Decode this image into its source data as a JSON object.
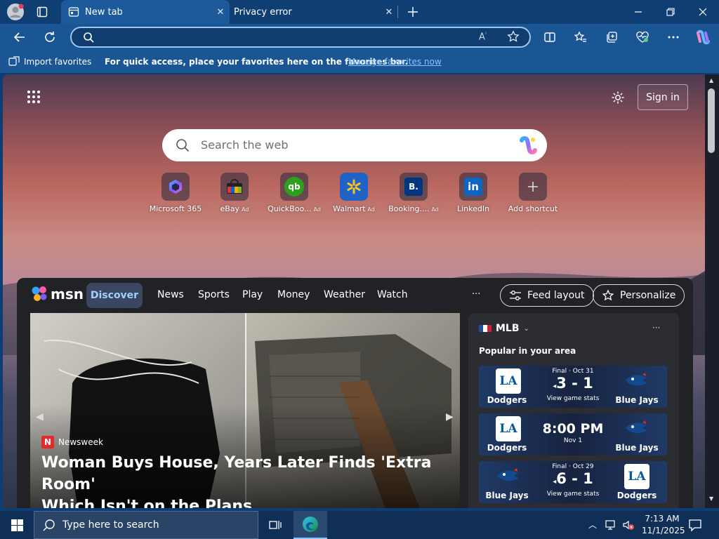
{
  "browser": {
    "tabs": [
      {
        "label": "New tab",
        "active": true
      },
      {
        "label": "Privacy error",
        "active": false
      }
    ],
    "address": {
      "value": "",
      "placeholder": ""
    },
    "favorites_bar": {
      "import_label": "Import favorites",
      "hint": "For quick access, place your favorites here on the favorites bar.",
      "manage_link": "Manage favorites now"
    }
  },
  "newtab": {
    "sign_in": "Sign in",
    "search_placeholder": "Search the web",
    "shortcuts": [
      {
        "label": "Microsoft 365",
        "ad": "",
        "icon": "microsoft-365-icon"
      },
      {
        "label": "eBay",
        "ad": "Ad",
        "icon": "ebay-icon"
      },
      {
        "label": "QuickBoo...",
        "ad": "Ad",
        "icon": "quickbooks-icon"
      },
      {
        "label": "Walmart",
        "ad": "Ad",
        "icon": "walmart-icon"
      },
      {
        "label": "Booking....",
        "ad": "Ad",
        "icon": "booking-icon"
      },
      {
        "label": "LinkedIn",
        "ad": "",
        "icon": "linkedin-icon"
      },
      {
        "label": "Add shortcut",
        "ad": "",
        "icon": "plus-icon"
      }
    ],
    "booking_glyph": "B.",
    "linkedin_glyph": "in",
    "qb_glyph": "qb"
  },
  "msn": {
    "brand": "msn",
    "nav": [
      "Discover",
      "News",
      "Sports",
      "Play",
      "Money",
      "Weather",
      "Watch"
    ],
    "more": "···",
    "feed_layout": "Feed layout",
    "personalize": "Personalize",
    "hero": {
      "source_badge": "N",
      "source": "Newsweek",
      "headline_1": "Woman Buys House, Years Later Finds 'Extra Room'",
      "headline_2": "Which Isn't on the Plans"
    },
    "mlb": {
      "title": "MLB",
      "more": "···",
      "subtitle": "Popular in your area",
      "games": [
        {
          "status": "Final · Oct 31",
          "score": "3 - 1",
          "sub": "View game stats",
          "left": "Dodgers",
          "right": "Blue Jays",
          "left_logo": "LA",
          "right_logo": "jays"
        },
        {
          "status": "",
          "score": "8:00 PM",
          "sub": "Nov 1",
          "left": "Dodgers",
          "right": "Blue Jays",
          "left_logo": "LA",
          "right_logo": "jays"
        },
        {
          "status": "Final · Oct 29",
          "score": "6 - 1",
          "sub": "View game stats",
          "left": "Blue Jays",
          "right": "Dodgers",
          "left_logo": "jays",
          "right_logo": "LA"
        }
      ]
    }
  },
  "taskbar": {
    "search_placeholder": "Type here to search",
    "time": "7:13 AM",
    "date": "11/1/2025"
  },
  "colors": {
    "titlebar": "#0f3e73",
    "toolbar": "#1a5594",
    "active_tab": "#1c5a9c",
    "discover_pill": "#3b4660",
    "feed_bg": "#202226",
    "link": "#8fc3ff"
  }
}
